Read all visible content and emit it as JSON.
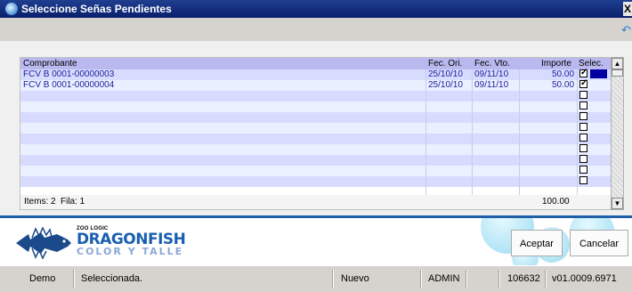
{
  "window": {
    "title": "Seleccione Señas Pendientes",
    "close_label": "X"
  },
  "grid": {
    "columns": [
      "Comprobante",
      "Fec. Ori.",
      "Fec. Vto.",
      "Importe",
      "Selec."
    ],
    "rows": [
      {
        "comprobante": "FCV B 0001-00000003",
        "fec_ori": "25/10/10",
        "fec_vto": "09/11/10",
        "importe": "50.00",
        "selected": true
      },
      {
        "comprobante": "FCV B 0001-00000004",
        "fec_ori": "25/10/10",
        "fec_vto": "09/11/10",
        "importe": "50.00",
        "selected": true
      }
    ],
    "empty_rows": 9,
    "footer": {
      "items": "Items: 2",
      "fila": "Fila: 1",
      "total": "100.00"
    }
  },
  "brand": {
    "small": "ZOO LOGIC",
    "main": "DRAGONFISH",
    "sub": "COLOR Y TALLE"
  },
  "buttons": {
    "accept": "Aceptar",
    "cancel": "Cancelar"
  },
  "statusbar": {
    "mode": "Demo",
    "message": "Seleccionada.",
    "state": "Nuevo",
    "user": "ADMIN",
    "number": "106632",
    "version": "v01.0009.6971"
  },
  "colors": {
    "titlebar": "#0a1f6c",
    "header": "#b9b9f0",
    "row_text": "#1c1c9c",
    "separator": "#1e5fa8",
    "logo": "#1a5fb0"
  }
}
